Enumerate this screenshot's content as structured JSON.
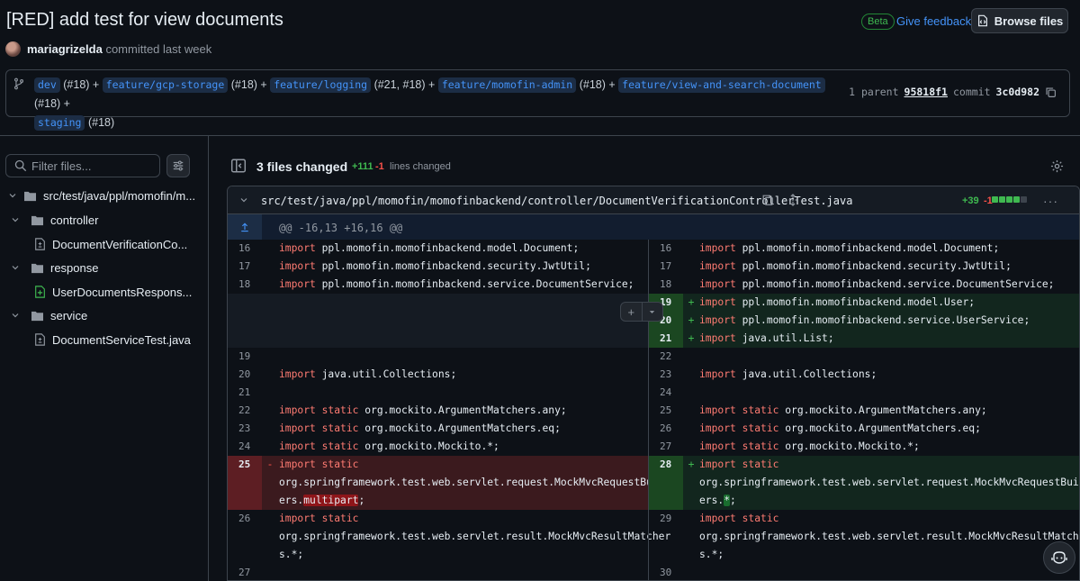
{
  "commit": {
    "title": "[RED] add test for view documents",
    "author": "mariagrizelda",
    "time_text": "committed last week",
    "beta_label": "Beta",
    "feedback_label": "Give feedback",
    "browse_label": "Browse files",
    "branches": [
      {
        "name": "dev",
        "ref": "(#18) +"
      },
      {
        "name": "feature/gcp-storage",
        "ref": "(#18) +"
      },
      {
        "name": "feature/logging",
        "ref": "(#21, #18) +"
      },
      {
        "name": "feature/momofin-admin",
        "ref": "(#18) +"
      },
      {
        "name": "feature/view-and-search-document",
        "ref": "(#18) +"
      },
      {
        "name": "staging",
        "ref": "(#18)"
      }
    ],
    "parent_label": "1 parent",
    "parent_sha": "95818f1",
    "commit_label": "commit",
    "commit_sha": "3c0d982"
  },
  "sidebar": {
    "filter_placeholder": "Filter files...",
    "tree": [
      {
        "label": "src/test/java/ppl/momofin/m...",
        "type": "folder"
      },
      {
        "label": "controller",
        "type": "folder"
      },
      {
        "label": "DocumentVerificationCo...",
        "type": "file-modified"
      },
      {
        "label": "response",
        "type": "folder"
      },
      {
        "label": "UserDocumentsRespons...",
        "type": "file-added"
      },
      {
        "label": "service",
        "type": "folder"
      },
      {
        "label": "DocumentServiceTest.java",
        "type": "file-modified"
      }
    ]
  },
  "summary": {
    "files_changed": "3 files changed",
    "additions": "+111",
    "deletions": "-1",
    "lines_changed": "lines changed"
  },
  "file": {
    "path": "src/test/java/ppl/momofin/momofinbackend/controller/DocumentVerificationControllerTest.java",
    "additions": "+39",
    "deletions": "-1",
    "hunk": "@@ -16,13 +16,16 @@",
    "left": [
      {
        "n": "16",
        "kw": "import",
        "t": " ppl.momofin.momofinbackend.model.Document;"
      },
      {
        "n": "17",
        "kw": "import",
        "t": " ppl.momofin.momofinbackend.security.JwtUtil;"
      },
      {
        "n": "18",
        "kw": "import",
        "t": " ppl.momofin.momofinbackend.service.DocumentService;"
      },
      {
        "n": "19",
        "kw": "",
        "t": ""
      },
      {
        "n": "20",
        "kw": "import",
        "t": " java.util.Collections;"
      },
      {
        "n": "21",
        "kw": "",
        "t": ""
      },
      {
        "n": "22",
        "kw": "import static",
        "t": " org.mockito.ArgumentMatchers.any;"
      },
      {
        "n": "23",
        "kw": "import static",
        "t": " org.mockito.ArgumentMatchers.eq;"
      },
      {
        "n": "24",
        "kw": "import static",
        "t": " org.mockito.Mockito.*;"
      },
      {
        "n": "26",
        "kw": "import static",
        "t": ""
      }
    ],
    "left_del": {
      "n": "25",
      "sign": "-",
      "kw": "import static",
      "l2": "org.springframework.test.web.servlet.request.MockMvcRequestBuild",
      "l3a": "ers.",
      "l3hl": "multipart",
      "l3b": ";"
    },
    "left_tail": {
      "l2": "org.springframework.test.web.servlet.result.MockMvcResultMatcher",
      "l3": "s.*;",
      "n_last": "27"
    },
    "right": [
      {
        "n": "16",
        "kw": "import",
        "t": " ppl.momofin.momofinbackend.model.Document;"
      },
      {
        "n": "17",
        "kw": "import",
        "t": " ppl.momofin.momofinbackend.security.JwtUtil;"
      },
      {
        "n": "18",
        "kw": "import",
        "t": " ppl.momofin.momofinbackend.service.DocumentService;"
      },
      {
        "n": "22",
        "kw": "",
        "t": ""
      },
      {
        "n": "23",
        "kw": "import",
        "t": " java.util.Collections;"
      },
      {
        "n": "24",
        "kw": "",
        "t": ""
      },
      {
        "n": "25",
        "kw": "import static",
        "t": " org.mockito.ArgumentMatchers.any;"
      },
      {
        "n": "26",
        "kw": "import static",
        "t": " org.mockito.ArgumentMatchers.eq;"
      },
      {
        "n": "27",
        "kw": "import static",
        "t": " org.mockito.Mockito.*;"
      },
      {
        "n": "29",
        "kw": "import static",
        "t": ""
      }
    ],
    "right_add": [
      {
        "n": "19",
        "sign": "+",
        "kw": "import",
        "t": " ppl.momofin.momofinbackend.model.User;"
      },
      {
        "n": "20",
        "sign": "+",
        "kw": "import",
        "t": " ppl.momofin.momofinbackend.service.UserService;"
      },
      {
        "n": "21",
        "sign": "+",
        "kw": "import",
        "t": " java.util.List;"
      }
    ],
    "right_add2": {
      "n": "28",
      "sign": "+",
      "kw": "import static",
      "l2": "org.springframework.test.web.servlet.request.MockMvcRequestBuild",
      "l3a": "ers.",
      "l3hl": "*",
      "l3b": ";"
    },
    "right_tail": {
      "l2": "org.springframework.test.web.servlet.result.MockMvcResultMatcher",
      "l3": "s.*;",
      "n_last": "30"
    }
  },
  "colors": {
    "background": "#0d1117",
    "accent": "#4493f8",
    "addition": "#3fb950",
    "deletion": "#f85149",
    "keyword": "#ff7b72"
  }
}
